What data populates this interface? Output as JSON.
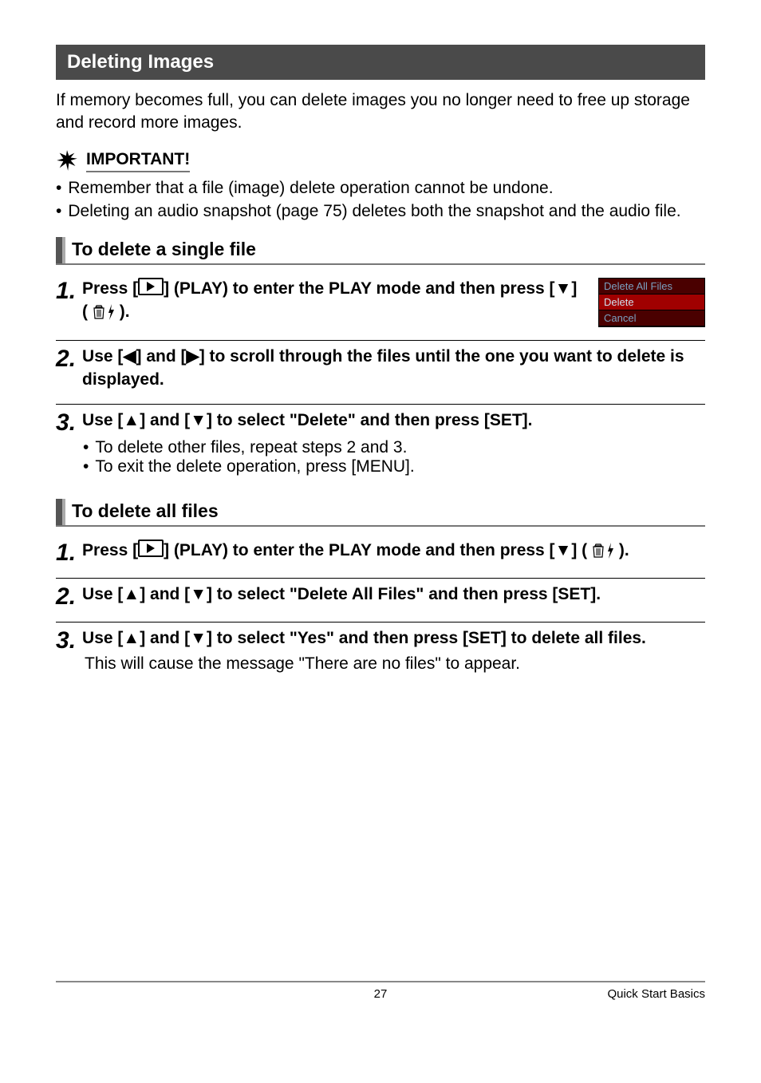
{
  "section": {
    "title": "Deleting Images"
  },
  "intro": "If memory becomes full, you can delete images you no longer need to free up storage and record more images.",
  "important": {
    "label": "IMPORTANT!",
    "items": [
      "Remember that a file (image) delete operation cannot be undone.",
      "Deleting an audio snapshot (page 75) deletes both the snapshot and the audio file."
    ]
  },
  "subsection1": {
    "title": "To delete a single file"
  },
  "s1": {
    "step1a": "Press [",
    "step1b": "] (PLAY) to enter the PLAY mode and then press [",
    "step1c": "] (",
    "step1d": ").",
    "menu": {
      "opt1": "Delete All Files",
      "opt2": "Delete",
      "opt3": "Cancel"
    },
    "step2a": "Use [",
    "step2b": "] and [",
    "step2c": "] to scroll through the files until the one you want to delete is displayed.",
    "step3a": "Use [",
    "step3b": "] and [",
    "step3c": "] to select \"Delete\" and then press [SET].",
    "step3_sub1": "To delete other files, repeat steps 2 and 3.",
    "step3_sub2": "To exit the delete operation, press [MENU]."
  },
  "subsection2": {
    "title": "To delete all files"
  },
  "s2": {
    "step1a": "Press [",
    "step1b": "] (PLAY) to enter the PLAY mode and then press [",
    "step1c": "] (",
    "step1d": ").",
    "step2a": "Use [",
    "step2b": "] and [",
    "step2c": "] to select \"Delete All Files\" and then press [SET].",
    "step3a": "Use [",
    "step3b": "] and [",
    "step3c": "] to select \"Yes\" and then press [SET] to delete all files.",
    "step3_note": "This will cause the message \"There are no files\" to appear."
  },
  "footer": {
    "page": "27",
    "section": "Quick Start Basics"
  }
}
